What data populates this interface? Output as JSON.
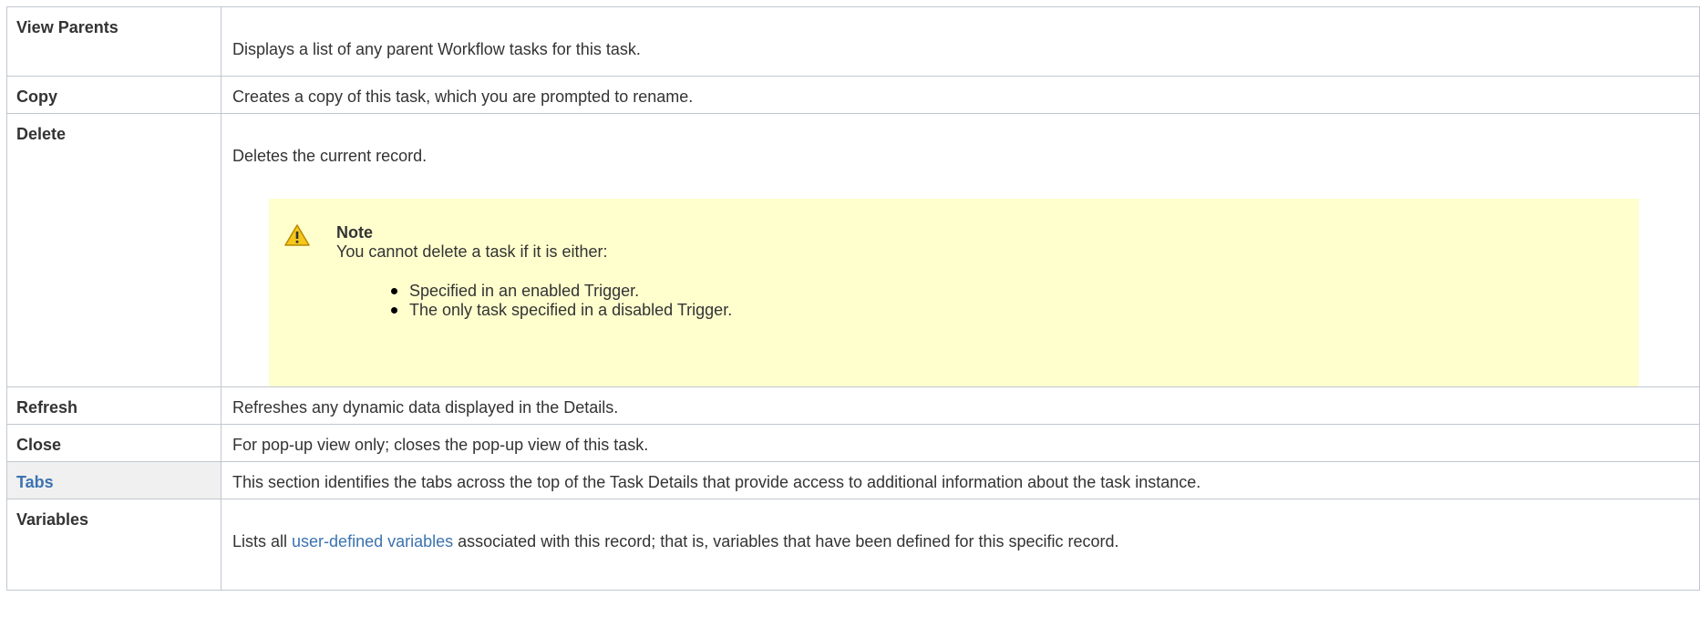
{
  "rows": [
    {
      "key": "View Parents",
      "value": "Displays a list of any parent Workflow tasks for this task."
    },
    {
      "key": "Copy",
      "value": "Creates a copy of this task, which you are prompted to rename."
    },
    {
      "key": "Delete",
      "value": "Deletes the current record."
    },
    {
      "key": "Refresh",
      "value": "Refreshes any dynamic data displayed in the Details."
    },
    {
      "key": "Close",
      "value": "For pop-up view only; closes the pop-up view of this task."
    },
    {
      "key": "Tabs",
      "value": "This section identifies the tabs across the top of the Task Details that provide access to additional information about the task instance."
    },
    {
      "key": "Variables",
      "value_before": "Lists all ",
      "link": "user-defined variables",
      "value_after": " associated with this record; that is, variables that have been defined for this specific record."
    }
  ],
  "note": {
    "icon": "warning-icon",
    "title": "Note",
    "text": "You cannot delete a task if it is either:",
    "items": [
      "Specified in an enabled Trigger.",
      "The only task specified in a disabled Trigger."
    ]
  },
  "colors": {
    "border": "#c1c7d0",
    "note_background": "#ffffce",
    "link": "#3b73af",
    "section_background": "#f0f0f0"
  }
}
